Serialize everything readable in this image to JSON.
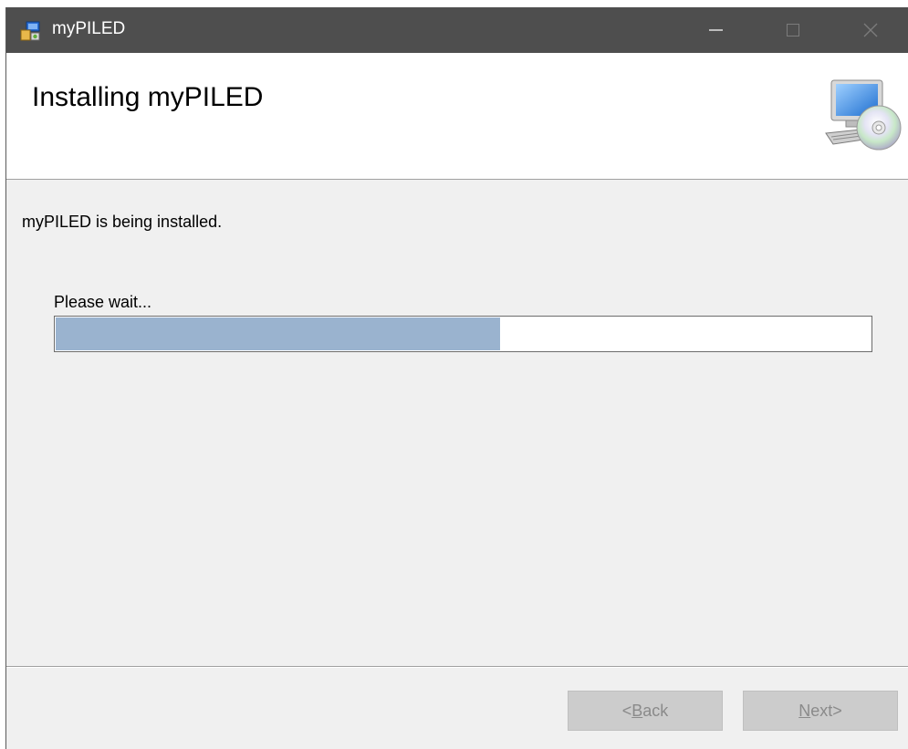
{
  "window": {
    "title": "myPILED",
    "app_icon": "installer-icon",
    "controls": {
      "minimize": "minimize-icon",
      "maximize": "maximize-icon",
      "close": "close-icon"
    }
  },
  "header": {
    "title": "Installing myPILED",
    "icon": "computer-cd-icon"
  },
  "body": {
    "status": "myPILED is being installed.",
    "wait_label": "Please wait...",
    "progress_fraction": 0.545
  },
  "footer": {
    "back": {
      "prefix": "< ",
      "mnemonic": "B",
      "rest": "ack",
      "enabled": false
    },
    "next": {
      "mnemonic": "N",
      "rest": "ext",
      "suffix": " >",
      "enabled": false
    }
  },
  "colors": {
    "titlebar": "#4e4e4e",
    "progress_fill": "#9ab3cf",
    "button_disabled_bg": "#cccccc",
    "button_disabled_text": "#8a8a8a"
  }
}
